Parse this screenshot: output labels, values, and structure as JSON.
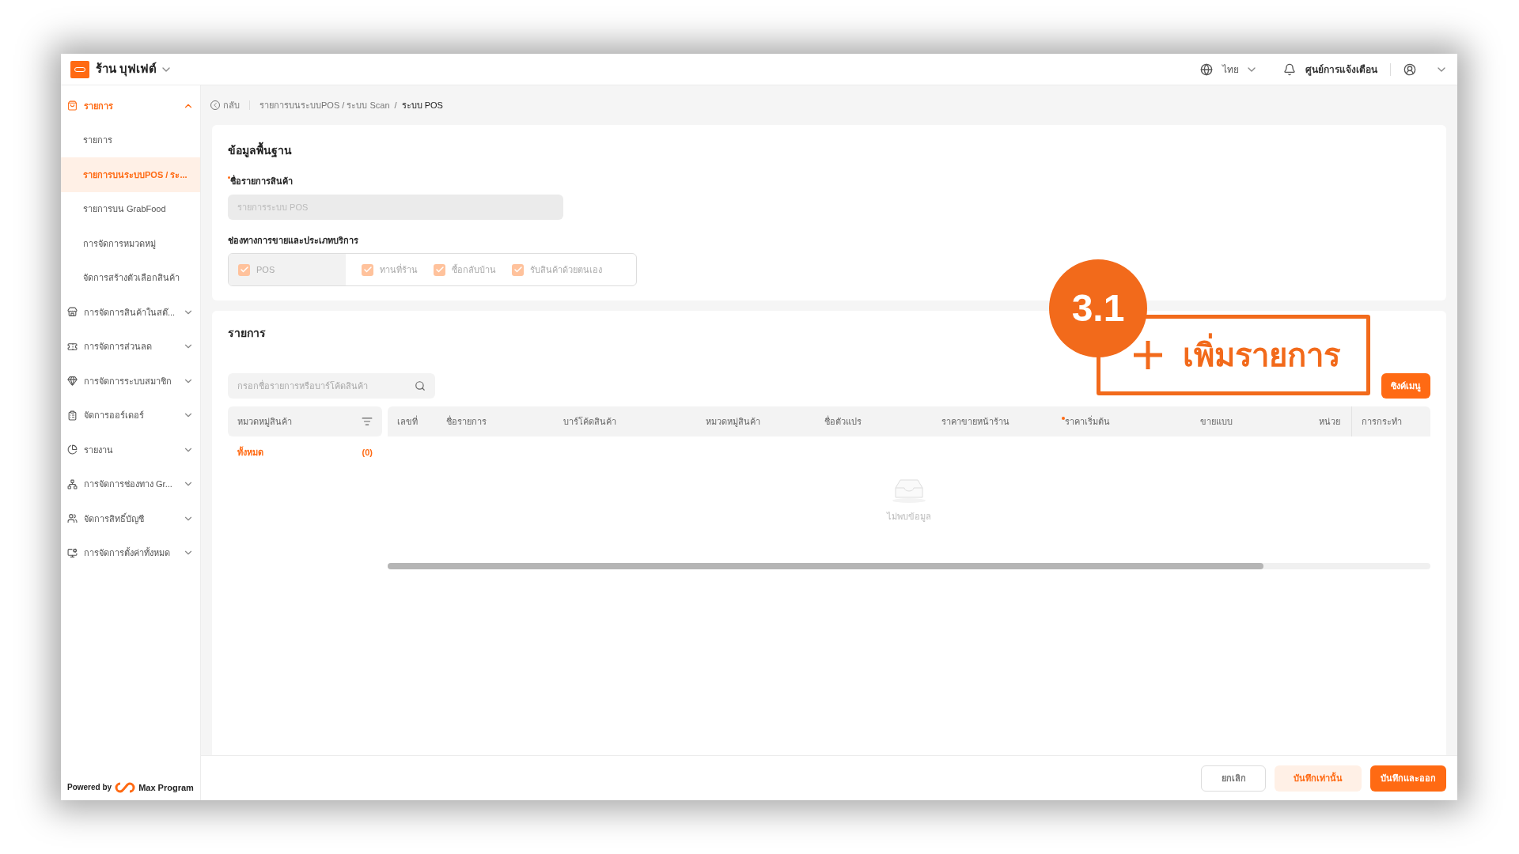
{
  "header": {
    "shop_name": "ร้าน บุฟเฟต์",
    "language": "ไทย",
    "notifications": "ศูนย์การแจ้งเตือน"
  },
  "sidebar": {
    "items": [
      {
        "label": "รายการ",
        "expanded": true,
        "selected": true,
        "children": [
          {
            "label": "รายการ",
            "selected": false
          },
          {
            "label": "รายการบนระบบPOS / ระ...",
            "selected": true
          },
          {
            "label": "รายการบน GrabFood",
            "selected": false
          },
          {
            "label": "การจัดการหมวดหมู่",
            "selected": false
          },
          {
            "label": "จัดการสร้างตัวเลือกสินค้า",
            "selected": false
          }
        ]
      },
      {
        "label": "การจัดการสินค้าในสต๊...",
        "expanded": false,
        "selected": false
      },
      {
        "label": "การจัดการส่วนลด",
        "expanded": false,
        "selected": false
      },
      {
        "label": "การจัดการระบบสมาชิก",
        "expanded": false,
        "selected": false
      },
      {
        "label": "จัดการออร์เดอร์",
        "expanded": false,
        "selected": false
      },
      {
        "label": "รายงาน",
        "expanded": false,
        "selected": false
      },
      {
        "label": "การจัดการช่องทาง Gr...",
        "expanded": false,
        "selected": false
      },
      {
        "label": "จัดการสิทธิ์บัญชี",
        "expanded": false,
        "selected": false
      },
      {
        "label": "การจัดการตั้งค่าทั้งหมด",
        "expanded": false,
        "selected": false
      }
    ],
    "powered_by": "Powered by",
    "brand": "Max Program"
  },
  "breadcrumb": {
    "back": "กลับ",
    "separator": "/",
    "items": [
      "รายการบนระบบPOS / ระบบ Scan",
      "ระบบ POS"
    ]
  },
  "basic_info": {
    "title": "ข้อมูลพื้นฐาน",
    "name_label": "ชื่อรายการสินค้า",
    "name_required": true,
    "name_placeholder": "รายการระบบ POS",
    "channels_label": "ช่องทางการขายและประเภทบริการ",
    "channels": [
      {
        "label": "POS",
        "checked": true,
        "disabled": true
      },
      {
        "label": "ทานที่ร้าน",
        "checked": true,
        "disabled": false
      },
      {
        "label": "ซื้อกลับบ้าน",
        "checked": true,
        "disabled": false
      },
      {
        "label": "รับสินค้าด้วยตนเอง",
        "checked": true,
        "disabled": false
      }
    ]
  },
  "items_section": {
    "title": "รายการ",
    "sync_button": "ซิงค์เมนู",
    "search_placeholder": "กรอกชื่อรายการหรือบาร์โค้ดสินค้า",
    "category_header": "หมวดหมู่สินค้า",
    "categories": [
      {
        "label": "ทั้งหมด",
        "count": "(0)",
        "selected": true
      }
    ],
    "columns": [
      {
        "label": "เลขที่",
        "required": false
      },
      {
        "label": "ชื่อรายการ",
        "required": false
      },
      {
        "label": "บาร์โค้ดสินค้า",
        "required": false
      },
      {
        "label": "หมวดหมู่สินค้า",
        "required": false
      },
      {
        "label": "ชื่อตัวแปร",
        "required": false
      },
      {
        "label": "ราคาขายหน้าร้าน",
        "required": false
      },
      {
        "label": "ราคาเริ่มต้น",
        "required": true
      },
      {
        "label": "ขายแบบ",
        "required": false
      },
      {
        "label": "หน่วย",
        "required": false
      },
      {
        "label": "การกระทำ",
        "required": false
      }
    ],
    "empty_text": "ไม่พบข้อมูล"
  },
  "footer": {
    "buttons": [
      {
        "label": "ยกเลิก",
        "kind": "outline"
      },
      {
        "label": "บันทึกเท่านั้น",
        "kind": "soft"
      },
      {
        "label": "บันทึกและออก",
        "kind": "primary"
      }
    ]
  },
  "annotation": {
    "step": "3.1",
    "label": "เพิ่มรายการ"
  }
}
